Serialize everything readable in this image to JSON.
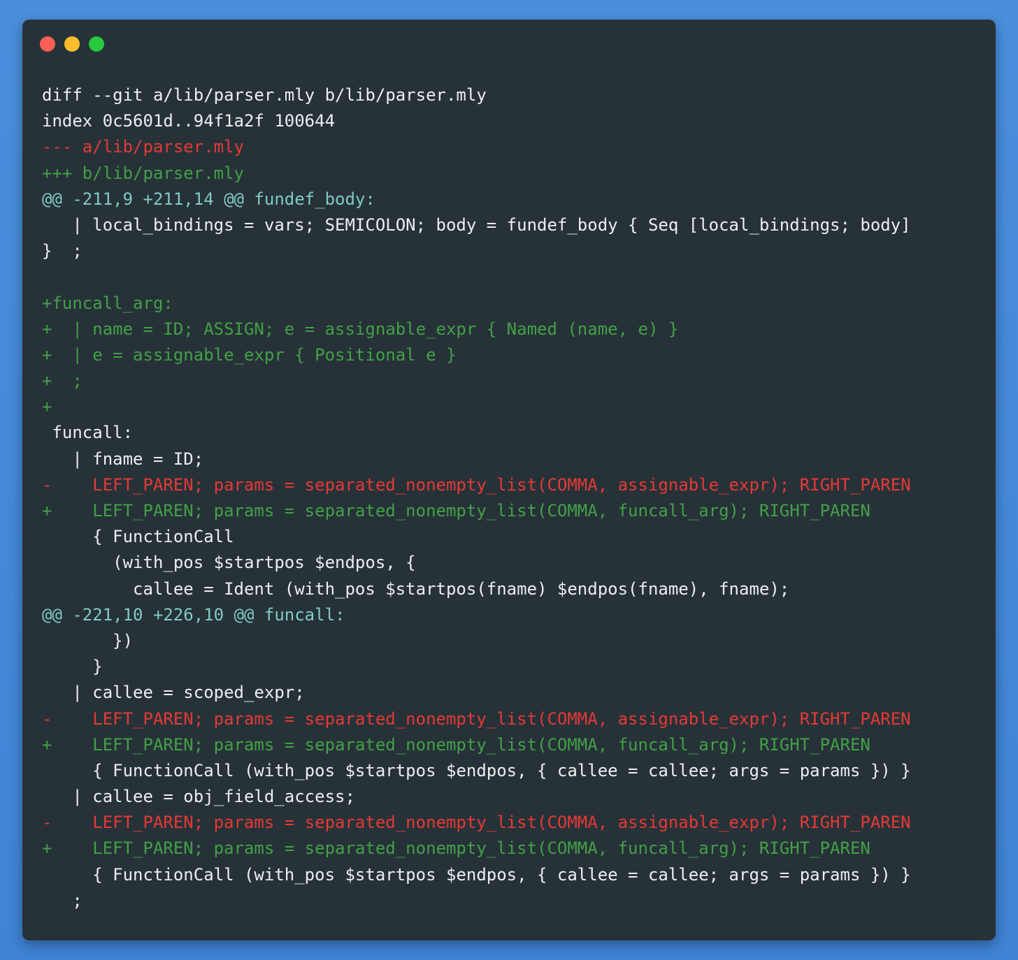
{
  "window": {
    "controls": {
      "close": "close",
      "minimize": "minimize",
      "maximize": "maximize"
    }
  },
  "colors": {
    "background": "#4589d9",
    "window": "#263238",
    "text": "#eceff1",
    "deleted": "#e53935",
    "added": "#43a047",
    "hunk": "#80cbc4"
  },
  "diff": {
    "lines": [
      {
        "type": "meta",
        "text": "diff --git a/lib/parser.mly b/lib/parser.mly"
      },
      {
        "type": "meta",
        "text": "index 0c5601d..94f1a2f 100644"
      },
      {
        "type": "del",
        "text": "--- a/lib/parser.mly"
      },
      {
        "type": "add",
        "text": "+++ b/lib/parser.mly"
      },
      {
        "type": "hunk",
        "text": "@@ -211,9 +211,14 @@ fundef_body:"
      },
      {
        "type": "ctx",
        "text": "   | local_bindings = vars; SEMICOLON; body = fundef_body { Seq [local_bindings; body]"
      },
      {
        "type": "ctx",
        "text": "}  ;"
      },
      {
        "type": "ctx",
        "text": ""
      },
      {
        "type": "add",
        "text": "+funcall_arg:"
      },
      {
        "type": "add",
        "text": "+  | name = ID; ASSIGN; e = assignable_expr { Named (name, e) }"
      },
      {
        "type": "add",
        "text": "+  | e = assignable_expr { Positional e }"
      },
      {
        "type": "add",
        "text": "+  ;"
      },
      {
        "type": "add",
        "text": "+"
      },
      {
        "type": "ctx",
        "text": " funcall:"
      },
      {
        "type": "ctx",
        "text": "   | fname = ID;"
      },
      {
        "type": "del",
        "text": "-    LEFT_PAREN; params = separated_nonempty_list(COMMA, assignable_expr); RIGHT_PAREN"
      },
      {
        "type": "add",
        "text": "+    LEFT_PAREN; params = separated_nonempty_list(COMMA, funcall_arg); RIGHT_PAREN"
      },
      {
        "type": "ctx",
        "text": "     { FunctionCall"
      },
      {
        "type": "ctx",
        "text": "       (with_pos $startpos $endpos, {"
      },
      {
        "type": "ctx",
        "text": "         callee = Ident (with_pos $startpos(fname) $endpos(fname), fname);"
      },
      {
        "type": "hunk",
        "text": "@@ -221,10 +226,10 @@ funcall:"
      },
      {
        "type": "ctx",
        "text": "       })"
      },
      {
        "type": "ctx",
        "text": "     }"
      },
      {
        "type": "ctx",
        "text": "   | callee = scoped_expr;"
      },
      {
        "type": "del",
        "text": "-    LEFT_PAREN; params = separated_nonempty_list(COMMA, assignable_expr); RIGHT_PAREN"
      },
      {
        "type": "add",
        "text": "+    LEFT_PAREN; params = separated_nonempty_list(COMMA, funcall_arg); RIGHT_PAREN"
      },
      {
        "type": "ctx",
        "text": "     { FunctionCall (with_pos $startpos $endpos, { callee = callee; args = params }) }"
      },
      {
        "type": "ctx",
        "text": "   | callee = obj_field_access;"
      },
      {
        "type": "del",
        "text": "-    LEFT_PAREN; params = separated_nonempty_list(COMMA, assignable_expr); RIGHT_PAREN"
      },
      {
        "type": "add",
        "text": "+    LEFT_PAREN; params = separated_nonempty_list(COMMA, funcall_arg); RIGHT_PAREN"
      },
      {
        "type": "ctx",
        "text": "     { FunctionCall (with_pos $startpos $endpos, { callee = callee; args = params }) }"
      },
      {
        "type": "ctx",
        "text": "   ;"
      }
    ]
  }
}
